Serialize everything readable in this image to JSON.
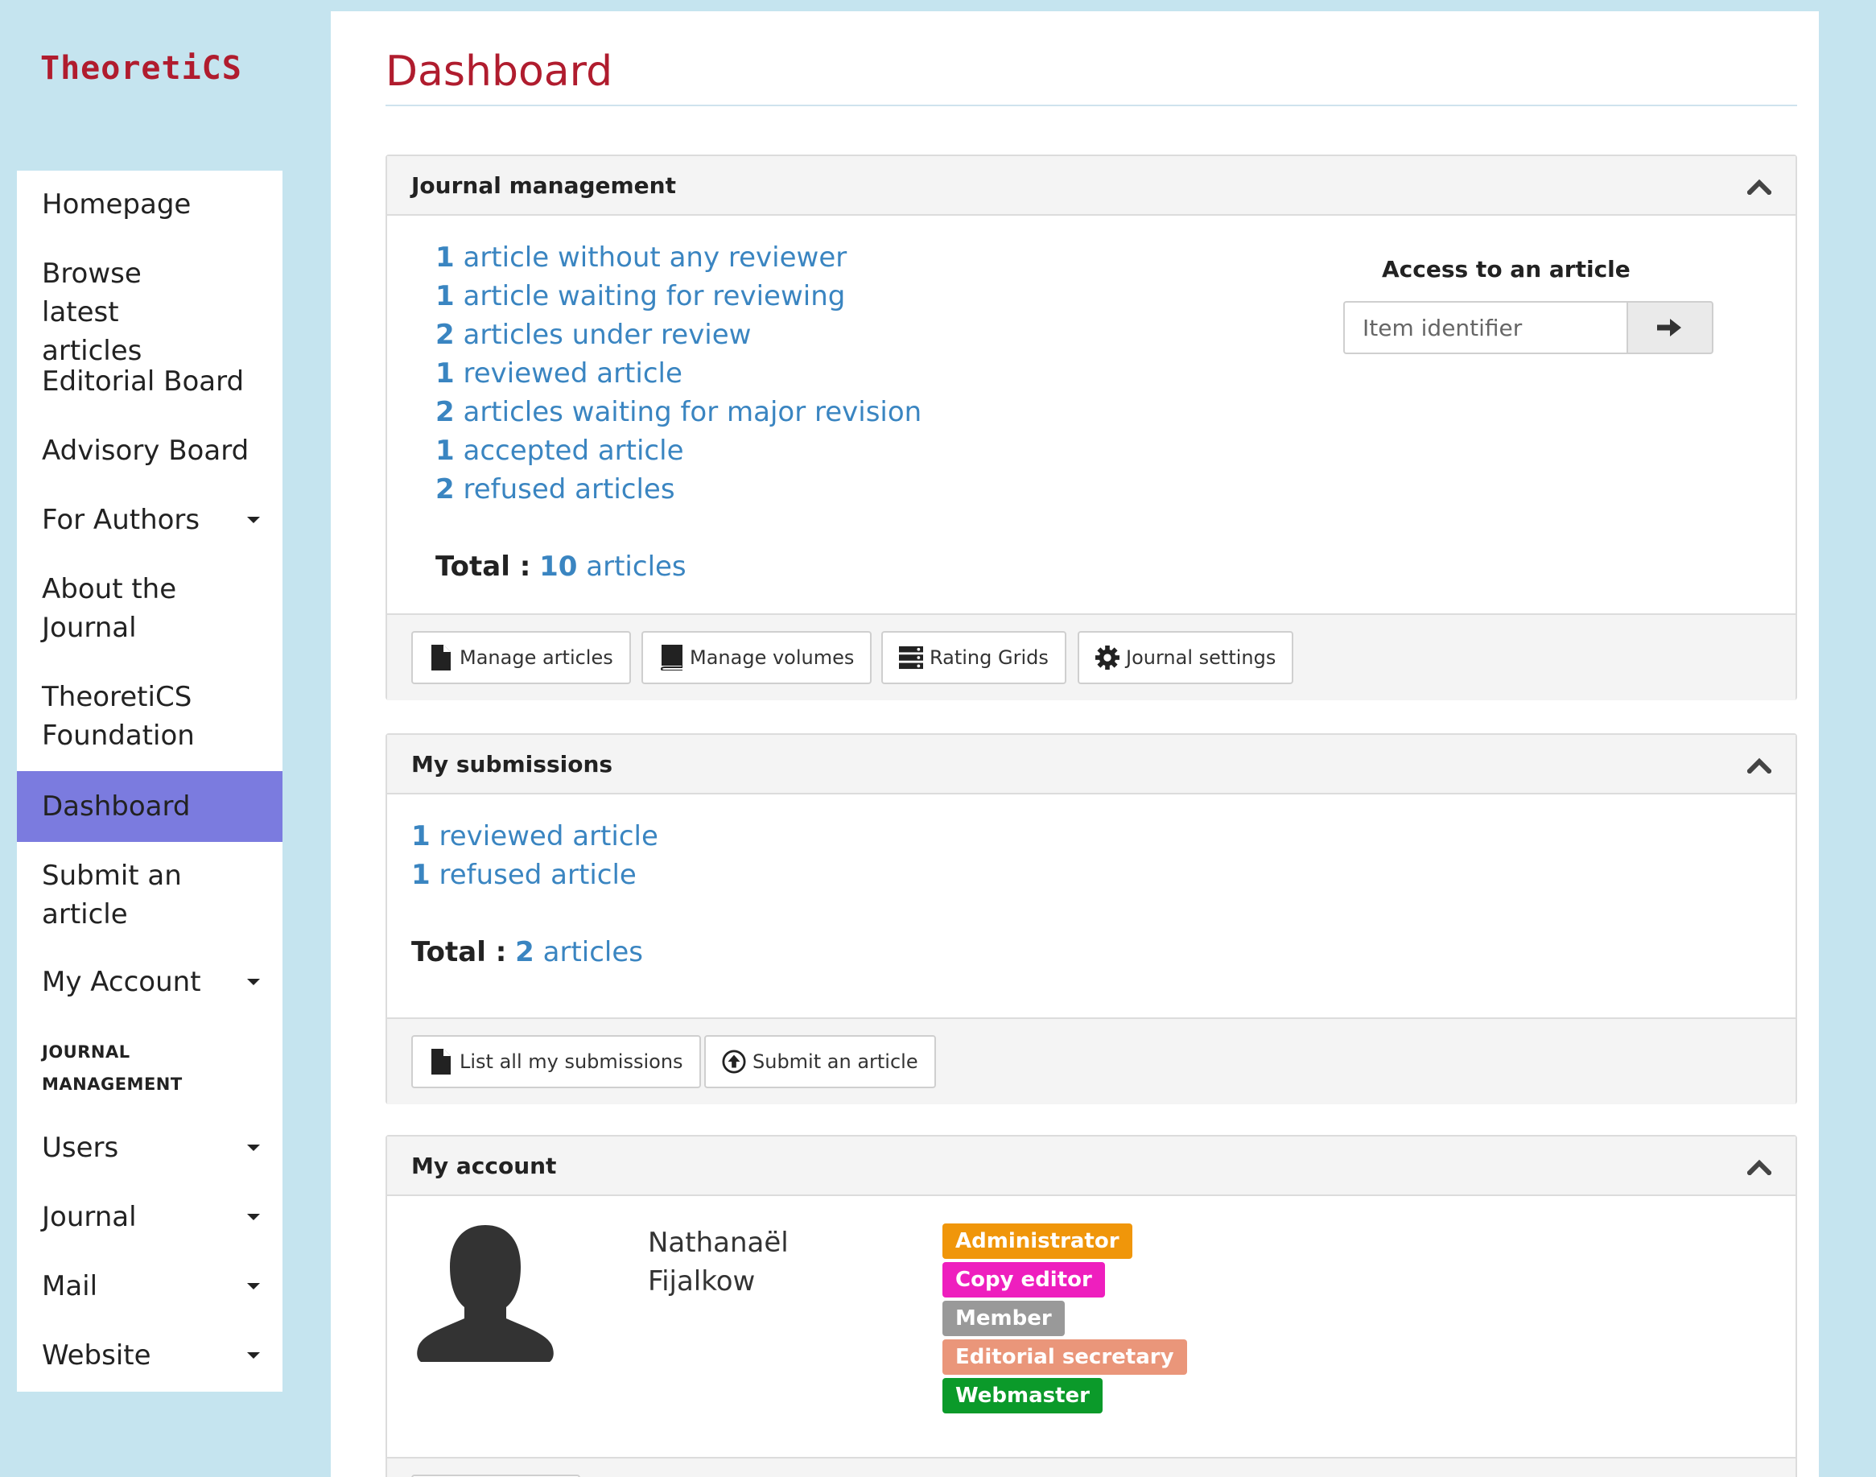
{
  "app": {
    "logo": "TheoretiCS"
  },
  "sidebar": {
    "items": [
      {
        "label": "Homepage"
      },
      {
        "label": "Browse latest articles"
      },
      {
        "label": "Editorial Board"
      },
      {
        "label": "Advisory Board"
      },
      {
        "label": "For Authors"
      },
      {
        "label": "About the Journal"
      },
      {
        "label": "TheoretiCS Foundation"
      },
      {
        "label": "Dashboard"
      },
      {
        "label": "Submit an article"
      },
      {
        "label": "My Account"
      }
    ],
    "section_title": "JOURNAL MANAGEMENT",
    "management_items": [
      {
        "label": "Users"
      },
      {
        "label": "Journal"
      },
      {
        "label": "Mail"
      },
      {
        "label": "Website"
      }
    ]
  },
  "page": {
    "title": "Dashboard"
  },
  "journal_management": {
    "title": "Journal management",
    "stats": [
      {
        "count": "1",
        "text": "article without any reviewer"
      },
      {
        "count": "1",
        "text": "article waiting for reviewing"
      },
      {
        "count": "2",
        "text": "articles under review"
      },
      {
        "count": "1",
        "text": "reviewed article"
      },
      {
        "count": "2",
        "text": "articles waiting for major revision"
      },
      {
        "count": "1",
        "text": "accepted article"
      },
      {
        "count": "2",
        "text": "refused articles"
      }
    ],
    "total_label": "Total :",
    "total_count": "10",
    "total_unit": "articles",
    "access": {
      "title": "Access to an article",
      "placeholder": "Item identifier"
    },
    "buttons": [
      {
        "label": "Manage articles",
        "icon": "file-icon"
      },
      {
        "label": "Manage volumes",
        "icon": "book-icon"
      },
      {
        "label": "Rating Grids",
        "icon": "server-icon"
      },
      {
        "label": "Journal settings",
        "icon": "gear-icon"
      }
    ]
  },
  "my_submissions": {
    "title": "My submissions",
    "stats": [
      {
        "count": "1",
        "text": "reviewed article"
      },
      {
        "count": "1",
        "text": "refused article"
      }
    ],
    "total_label": "Total :",
    "total_count": "2",
    "total_unit": "articles",
    "buttons": [
      {
        "label": "List all my submissions",
        "icon": "file-icon"
      },
      {
        "label": "Submit an article",
        "icon": "upload-circle-icon"
      }
    ]
  },
  "my_account": {
    "title": "My account",
    "first_name": "Nathanaël",
    "last_name": "Fijalkow",
    "roles": [
      {
        "label": "Administrator",
        "color": "#f0960a"
      },
      {
        "label": "Copy editor",
        "color": "#ee1fbe"
      },
      {
        "label": "Member",
        "color": "#999999"
      },
      {
        "label": "Editorial secretary",
        "color": "#ea967a"
      },
      {
        "label": "Webmaster",
        "color": "#0b9a2a"
      }
    ]
  },
  "colors": {
    "accent": "#b01c2e",
    "link": "#3a85c1",
    "active_nav": "#7b7bdf",
    "sidebar_bg": "#c5e4ef"
  }
}
